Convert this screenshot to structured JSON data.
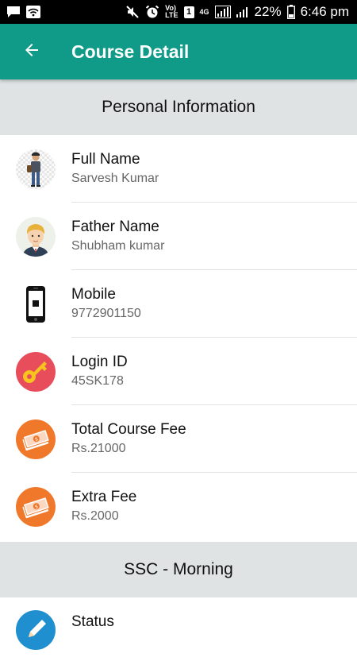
{
  "status_bar": {
    "battery": "22%",
    "time": "6:46 pm",
    "volte": "Vo)\nLTE",
    "sim": "1",
    "network": "4G"
  },
  "app_bar": {
    "title": "Course Detail",
    "color": "#0f9b87"
  },
  "sections": [
    {
      "title": "Personal Information"
    },
    {
      "title": "SSC - Morning"
    }
  ],
  "rows": [
    {
      "label": "Full Name",
      "value": "Sarvesh Kumar",
      "icon": "person-avatar-icon"
    },
    {
      "label": "Father Name",
      "value": "Shubham kumar",
      "icon": "man-avatar-icon"
    },
    {
      "label": "Mobile",
      "value": "9772901150",
      "icon": "mobile-phone-icon"
    },
    {
      "label": "Login ID",
      "value": "45SK178",
      "icon": "key-icon"
    },
    {
      "label": "Total Course Fee",
      "value": "Rs.21000",
      "icon": "money-icon"
    },
    {
      "label": "Extra Fee",
      "value": "Rs.2000",
      "icon": "money-icon"
    },
    {
      "label": "Status",
      "value": "",
      "icon": "pencil-icon"
    }
  ]
}
